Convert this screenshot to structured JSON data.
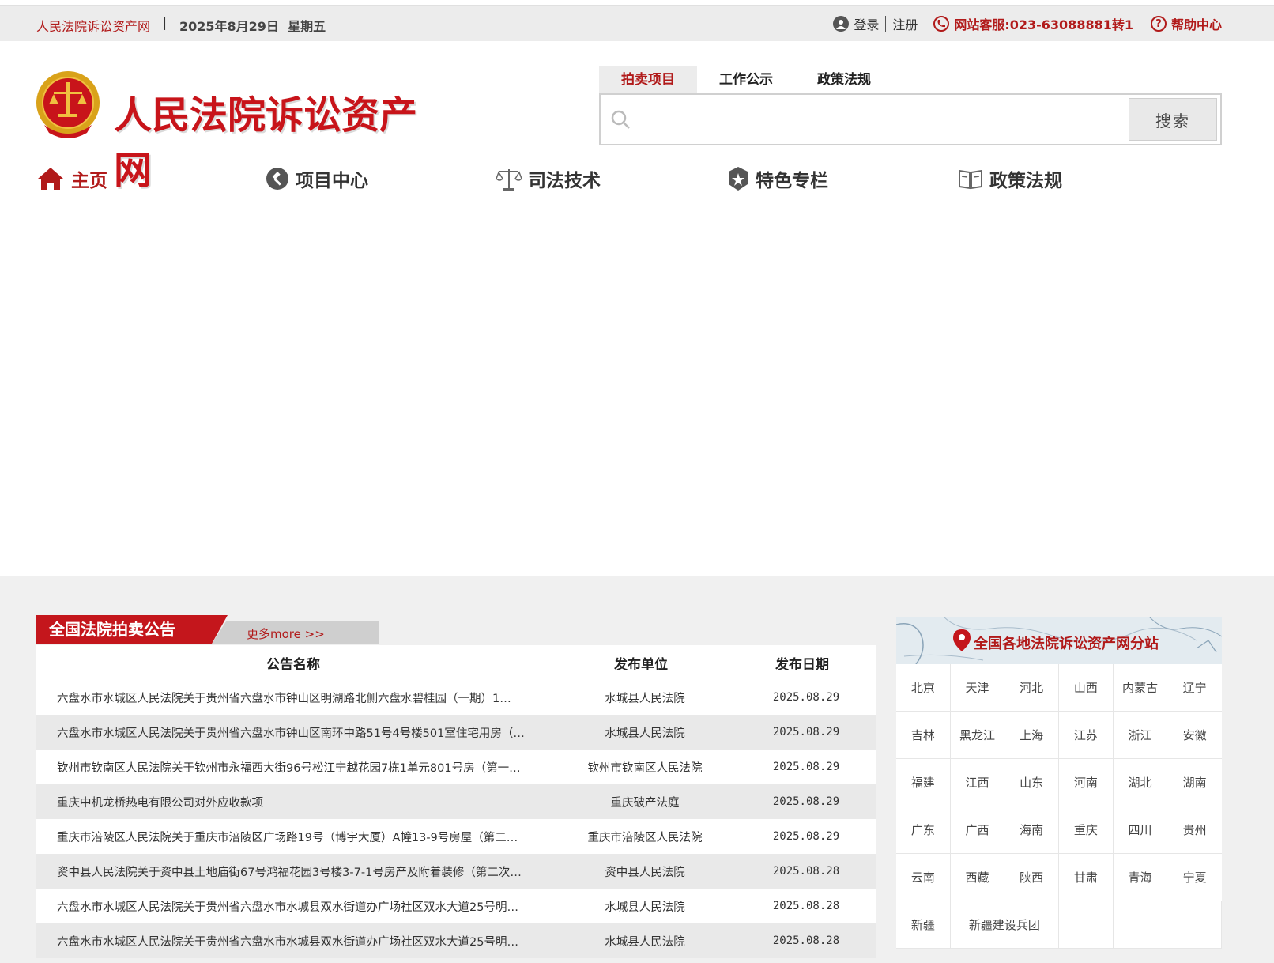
{
  "topbar": {
    "site_name": "人民法院诉讼资产网",
    "separator": "|",
    "date": "2025年8月29日  星期五",
    "login": "登录",
    "register": "注册",
    "hotline": "网站客服:023-63088881转1",
    "help": "帮助中心"
  },
  "header": {
    "logo_title": "人民法院诉讼资产网",
    "search_tabs": [
      "拍卖项目",
      "工作公示",
      "政策法规"
    ],
    "search_placeholder": "",
    "search_button": "搜索"
  },
  "nav": {
    "items": [
      "主页",
      "项目中心",
      "司法技术",
      "特色专栏",
      "政策法规"
    ]
  },
  "notice": {
    "title": "全国法院拍卖公告",
    "more": "更多more >>",
    "columns": [
      "公告名称",
      "发布单位",
      "发布日期"
    ],
    "rows": [
      {
        "name": "六盘水市水城区人民法院关于贵州省六盘水市钟山区明湖路北侧六盘水碧桂园（一期）1…",
        "unit": "水城县人民法院",
        "date": "2025.08.29"
      },
      {
        "name": "六盘水市水城区人民法院关于贵州省六盘水市钟山区南环中路51号4号楼501室住宅用房（…",
        "unit": "水城县人民法院",
        "date": "2025.08.29"
      },
      {
        "name": "钦州市钦南区人民法院关于钦州市永福西大街96号松江宁越花园7栋1单元801号房（第一…",
        "unit": "钦州市钦南区人民法院",
        "date": "2025.08.29"
      },
      {
        "name": "重庆中机龙桥热电有限公司对外应收款项",
        "unit": "重庆破产法庭",
        "date": "2025.08.29"
      },
      {
        "name": "重庆市涪陵区人民法院关于重庆市涪陵区广场路19号（博宇大厦）A幢13-9号房屋（第二…",
        "unit": "重庆市涪陵区人民法院",
        "date": "2025.08.29"
      },
      {
        "name": "资中县人民法院关于资中县土地庙街67号鸿福花园3号楼3-7-1号房产及附着装修（第二次…",
        "unit": "资中县人民法院",
        "date": "2025.08.28"
      },
      {
        "name": "六盘水市水城区人民法院关于贵州省六盘水市水城县双水街道办广场社区双水大道25号明…",
        "unit": "水城县人民法院",
        "date": "2025.08.28"
      },
      {
        "name": "六盘水市水城区人民法院关于贵州省六盘水市水城县双水街道办广场社区双水大道25号明…",
        "unit": "水城县人民法院",
        "date": "2025.08.28"
      }
    ]
  },
  "branch": {
    "title": "全国各地法院诉讼资产网分站",
    "regions": [
      "北京",
      "天津",
      "河北",
      "山西",
      "内蒙古",
      "辽宁",
      "吉林",
      "黑龙江",
      "上海",
      "江苏",
      "浙江",
      "安徽",
      "福建",
      "江西",
      "山东",
      "河南",
      "湖北",
      "湖南",
      "广东",
      "广西",
      "海南",
      "重庆",
      "四川",
      "贵州",
      "云南",
      "西藏",
      "陕西",
      "甘肃",
      "青海",
      "宁夏",
      "新疆",
      "新疆建设兵团"
    ]
  },
  "colors": {
    "brand_red": "#c4161c",
    "bar_gray": "#ececec",
    "section_bg": "#f0f0f0"
  }
}
